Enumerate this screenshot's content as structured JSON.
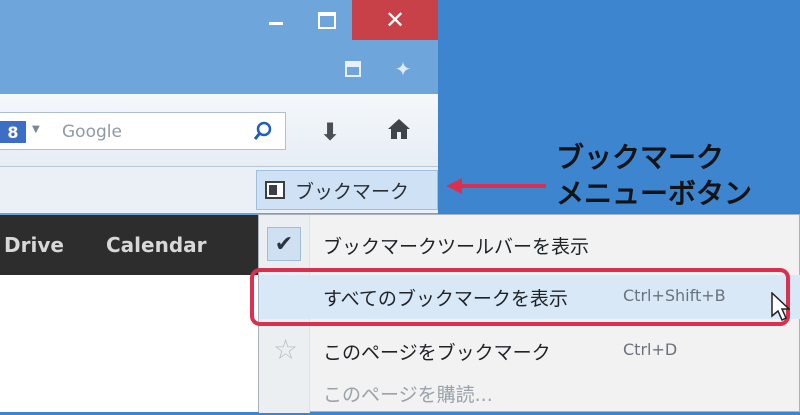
{
  "search": {
    "placeholder": "Google",
    "engine_letter": "8"
  },
  "bookmarks_menu_button": {
    "label": "ブックマーク"
  },
  "google_bar": {
    "items": [
      "Drive",
      "Calendar"
    ]
  },
  "dropdown": {
    "items": [
      {
        "label": "ブックマークツールバーを表示",
        "shortcut": "",
        "checked": true
      },
      {
        "label": "すべてのブックマークを表示",
        "shortcut": "Ctrl+Shift+B",
        "highlighted": true
      },
      {
        "label": "このページをブックマーク",
        "shortcut": "Ctrl+D"
      },
      {
        "label": "このページを購読...",
        "shortcut": "",
        "disabled": true
      }
    ]
  },
  "window_controls": {
    "close_symbol": "✕"
  },
  "annotation": {
    "text": "ブックマーク\nメニューボタン"
  },
  "colors": {
    "accent_red": "#d9304f",
    "window_blue": "#6ea5db",
    "close_red": "#c94148"
  }
}
